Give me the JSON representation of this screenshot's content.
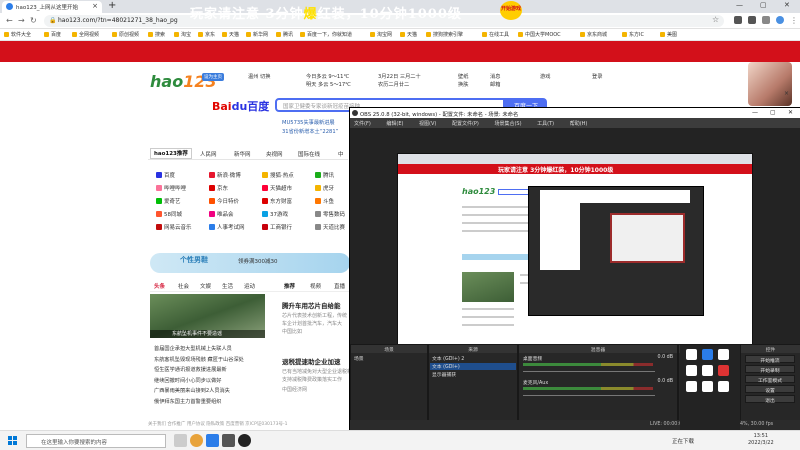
{
  "browser": {
    "tab_title": "hao123_上网从这里开始",
    "url": "hao123.com/?tn=48021271_38_hao_pg",
    "bookmarks": [
      "软件大全",
      "百度",
      "全网视频",
      "原创视频",
      "搜索",
      "淘宝",
      "京东",
      "天猫",
      "新华网",
      "腾讯",
      "百度一下，你就知道",
      "淘宝网",
      "天猫",
      "搜狗搜索引擎",
      "在线工具",
      "中国大学MOOC",
      "京东商城",
      "东方IC",
      "美图"
    ]
  },
  "banner": {
    "title_a": "玩家请注意",
    "title_b": "3分钟",
    "title_hl": "爆",
    "title_c": "红装，10分钟1000级",
    "badge": "开始游戏"
  },
  "hao": {
    "logo_a": "hao",
    "logo_b": "123",
    "tag": "设为主页",
    "info": [
      "温州 切换",
      "今日多云 9～11℃",
      "3月22日 三月二十",
      "农历二月廿二",
      "壁纸",
      "换肤",
      "消息",
      "邮箱",
      "游戏",
      "登录"
    ],
    "weather2": "明天 多云 5～17℃",
    "baidu_a": "Bai",
    "baidu_b": "du百度",
    "search_placeholder": "国家卫健委专家谈新冠疫苗接种",
    "search_btn": "百度一下",
    "news_tip": "MU5735失事最新进展",
    "news_tip2": "31省份新增本土“2281”",
    "nav_tabs": [
      "hao123推荐",
      "人民网",
      "新华网",
      "央视网",
      "国际在线",
      "中"
    ],
    "sites": [
      {
        "name": "百度",
        "color": "#2932e1"
      },
      {
        "name": "新浪·微博",
        "color": "#e6162d"
      },
      {
        "name": "搜狐·热点",
        "color": "#f4b400"
      },
      {
        "name": "腾讯",
        "color": "#1aad19"
      },
      {
        "name": "哔哩哔哩",
        "color": "#fb7299"
      },
      {
        "name": "京东",
        "color": "#d00"
      },
      {
        "name": "天猫超市",
        "color": "#ff0036"
      },
      {
        "name": "虎牙",
        "color": "#f4b400"
      },
      {
        "name": "爱奇艺",
        "color": "#00be06"
      },
      {
        "name": "今日特价",
        "color": "#ff5000"
      },
      {
        "name": "东方财富",
        "color": "#d00"
      },
      {
        "name": "斗鱼",
        "color": "#ff7700"
      },
      {
        "name": "58同城",
        "color": "#ff552e"
      },
      {
        "name": "唯品会",
        "color": "#f10180"
      },
      {
        "name": "37游戏",
        "color": "#0aa1e4"
      },
      {
        "name": "零售数码",
        "color": "#888"
      },
      {
        "name": "网易云音乐",
        "color": "#c20c0c"
      },
      {
        "name": "人事考试网",
        "color": "#2b7de9"
      },
      {
        "name": "工商银行",
        "color": "#c7000b"
      },
      {
        "name": "天道比赛",
        "color": "#888"
      }
    ],
    "promo_tag": "个性男鞋",
    "promo_sub": "领券满300减30",
    "cats": [
      "头条",
      "社会",
      "文娱",
      "生活",
      "运动"
    ],
    "cats2": [
      "推荐",
      "视频",
      "直播"
    ],
    "img_caption": "东航坠机事件不要造谣",
    "news_lines": [
      "首届国企承担大型机械上失联人员",
      "东航客机坠毁现场残骸 藏匿于山谷深处",
      "恒生医学通讯报道救援进展最新",
      "继续回撤时间小心同步以做好",
      "广西暴雨美丽来山接到2人员消失",
      "俄伊拜东国主力首警重要组织"
    ],
    "headline1": "腾升车用芯片自给能",
    "para1": [
      "芯片代表技术创新工程，传统",
      "车企计划首批汽车，汽车大",
      "中国比如"
    ],
    "headline2": "退税提速助企业加速",
    "para2": [
      "已有当地减免对大型企业退税新增",
      "支持减税降费政策落实工作",
      "中国经济网"
    ],
    "footer": "关于我们  合作推广  用户协议  隐私政策  百度营销  京ICP证030173号-1"
  },
  "taskbar": {
    "search_placeholder": "在这里输入你要搜索的内容",
    "tray": "正在下载",
    "time": "13:51",
    "date": "2022/3/22"
  },
  "obs": {
    "title": "OBS 25.0.8 (32-bit, windows) - 配置文件: 未命名 - 场景: 未命名",
    "menu": [
      "文件(F)",
      "编辑(E)",
      "视图(V)",
      "配置文件(P)",
      "场景集合(S)",
      "工具(T)",
      "帮助(H)"
    ],
    "docks": {
      "scenes": "场景",
      "scene_item": "场景",
      "sources": "来源",
      "source_items": [
        "文本 (GDI+) 2",
        "文本 (GDI+)",
        "显示器捕获"
      ],
      "mixer": "混音器",
      "mixer_items": [
        "桌面音频",
        "麦克风/Aux"
      ],
      "mixer_db": [
        "0.0 dB",
        "0.0 dB"
      ],
      "transitions": "转场特效",
      "trans_type": "渐变",
      "duration_label": "时长",
      "duration_value": "300 ms",
      "controls": "控件",
      "control_buttons": [
        "开始推流",
        "开始录制",
        "工作室模式",
        "设置",
        "退出"
      ]
    },
    "status": "LIVE: 00:00:00   REC: 00:00:00   CPU: 2.4%, 30.00 fps",
    "preview_banner": "玩家请注意 3分钟爆红装，10分钟1000级",
    "preview_logo": "hao123"
  }
}
